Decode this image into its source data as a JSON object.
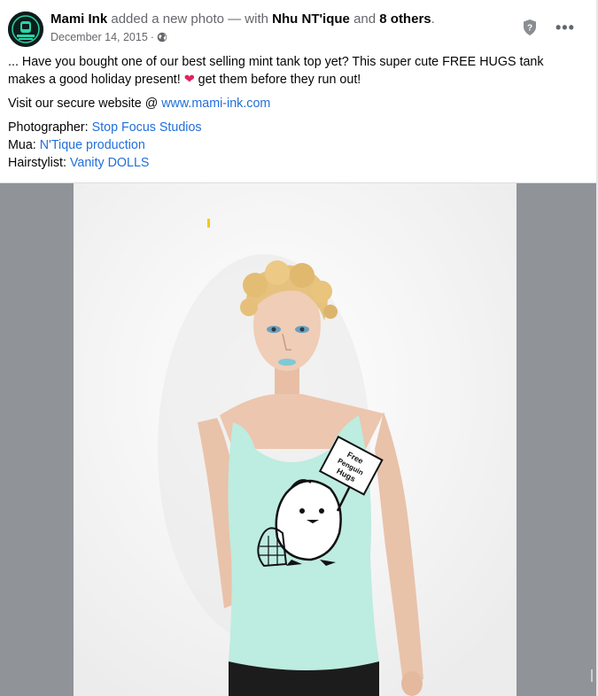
{
  "post": {
    "author": "Mami Ink",
    "action_text": "added a new photo — with",
    "tagged": "Nhu NT'ique",
    "and_text": "and",
    "others": "8 others",
    "period": ".",
    "date": "December 14, 2015",
    "separator": "·",
    "privacy_icon": "globe-icon",
    "body": {
      "para1_a": "... Have you bought one of our best selling mint tank top yet? This super cute FREE HUGS tank makes a good holiday present!",
      "para1_b": "get them before they run out!",
      "para2_prefix": "Visit our secure website @",
      "para2_link": "www.mami-ink.com",
      "credits": [
        {
          "label": "Photographer:",
          "value": "Stop Focus Studios"
        },
        {
          "label": "Mua:",
          "value": "N'Tique production"
        },
        {
          "label": "Hairstylist:",
          "value": "Vanity DOLLS"
        }
      ]
    },
    "shirt_text": [
      "Free",
      "Penguin",
      "Hugs"
    ]
  },
  "icons": {
    "admin": "shield-question-icon",
    "more": "more-options-icon",
    "heart": "red-heart-emoji"
  },
  "colors": {
    "link": "#216fdb",
    "muted": "#65676b",
    "shirt": "#bdece0",
    "photo_bg": "#909398"
  }
}
